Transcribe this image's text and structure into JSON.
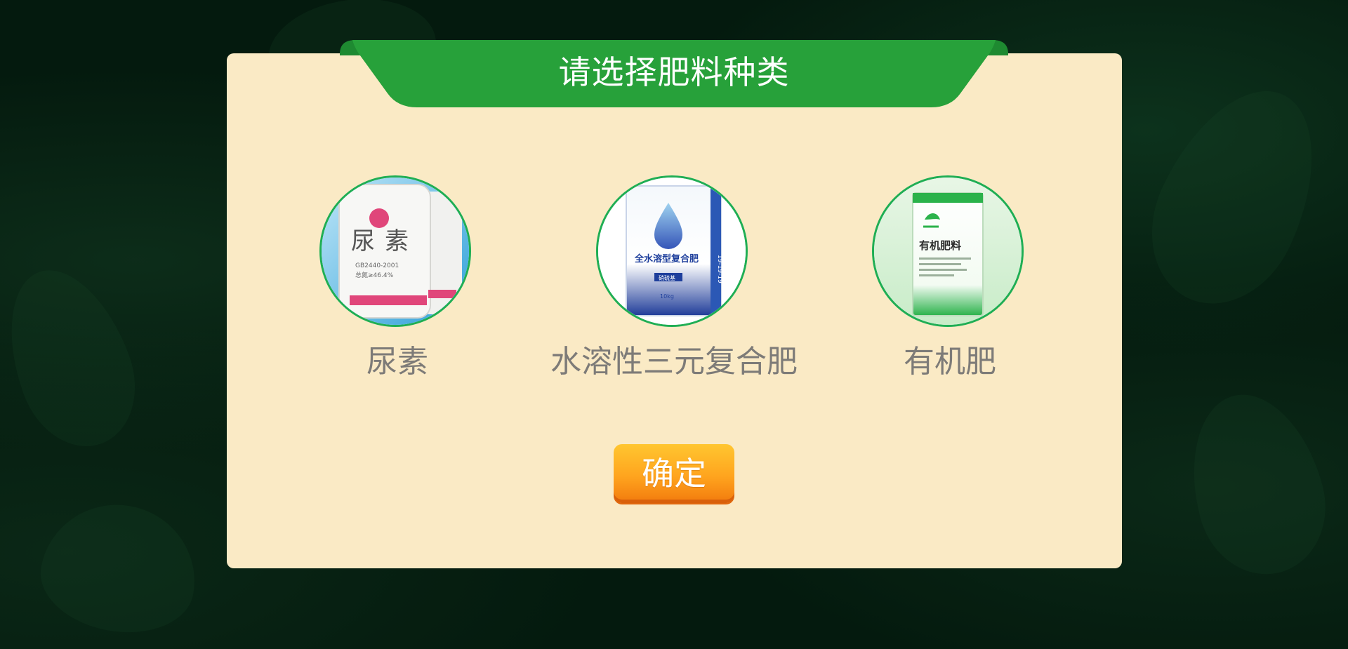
{
  "dialog": {
    "title": "请选择肥料种类",
    "options": [
      {
        "label": "尿素",
        "image": "urea-bag-icon",
        "bag_text": [
          "尿",
          "素",
          "GB2440-2001",
          "总氮≥46.4%"
        ]
      },
      {
        "label": "水溶性三元复合肥",
        "image": "water-soluble-fertilizer-bag-icon",
        "bag_text": [
          "全水溶型复合肥",
          "硝硫基",
          "10kg",
          "19-19-19"
        ]
      },
      {
        "label": "有机肥",
        "image": "organic-fertilizer-bag-icon",
        "bag_text": [
          "有机肥料"
        ]
      }
    ],
    "confirm_label": "确定"
  },
  "colors": {
    "background": "#041a0e",
    "panel": "#faeac5",
    "banner": "#27a13a",
    "ring": "#1fae54",
    "label": "#7d7b78",
    "button": "#ffa41e"
  }
}
